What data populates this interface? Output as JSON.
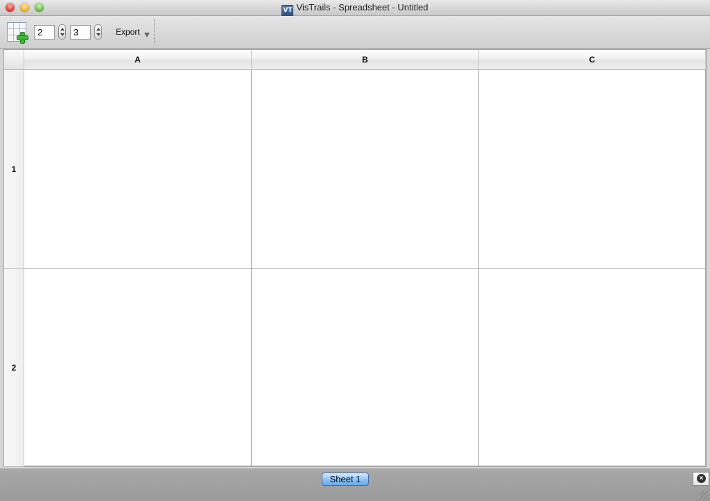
{
  "window": {
    "title": "VisTrails - Spreadsheet - Untitled",
    "app_icon_text": "VT"
  },
  "toolbar": {
    "rows_value": "2",
    "cols_value": "3",
    "export_label": "Export",
    "icons": {
      "add_sheet": "grid-plus-icon",
      "export_menu": "chevron-down-icon"
    }
  },
  "spreadsheet": {
    "columns": [
      "A",
      "B",
      "C"
    ],
    "rows": [
      "1",
      "2"
    ]
  },
  "tabs": {
    "items": [
      {
        "label": "Sheet 1",
        "active": true
      }
    ],
    "close_icon": "close-icon"
  },
  "colors": {
    "active_tab": "#8cc2f5",
    "add_icon_green": "#3fb83a"
  }
}
